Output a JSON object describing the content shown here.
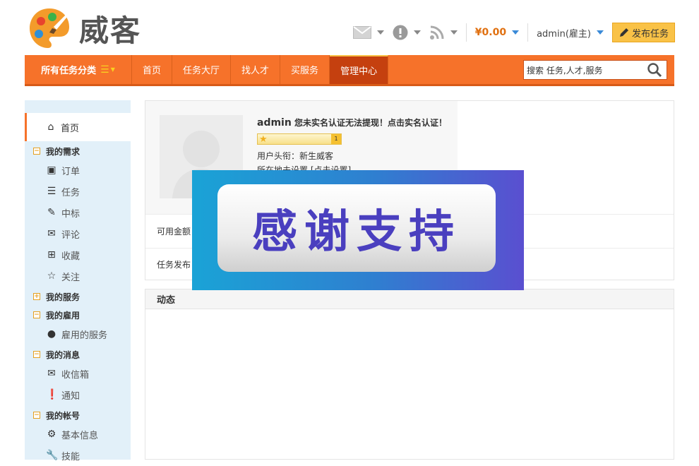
{
  "brand": {
    "name": "威客",
    "accent": "#f6722a"
  },
  "topbar": {
    "message_icon": "mail-icon",
    "notice_icon": "alert-icon",
    "rss_icon": "rss-icon",
    "balance": "¥0.00",
    "user": "admin(雇主)",
    "publish_label": "发布任务"
  },
  "nav": {
    "all_categories": "所有任务分类",
    "items": [
      {
        "label": "首页"
      },
      {
        "label": "任务大厅"
      },
      {
        "label": "找人才"
      },
      {
        "label": "买服务"
      },
      {
        "label": "管理中心",
        "active": true
      }
    ],
    "search_value": "搜索 任务,人才,服务"
  },
  "sidebar": {
    "home": "首页",
    "groups": [
      {
        "title": "我的需求",
        "expanded": true,
        "items": [
          {
            "label": "订单",
            "icon": "order-icon"
          },
          {
            "label": "任务",
            "icon": "list-icon"
          },
          {
            "label": "中标",
            "icon": "edit-icon"
          },
          {
            "label": "评论",
            "icon": "comment-icon"
          },
          {
            "label": "收藏",
            "icon": "plus-square-icon"
          },
          {
            "label": "关注",
            "icon": "star-icon"
          }
        ]
      },
      {
        "title": "我的服务",
        "expanded": false,
        "items": []
      },
      {
        "title": "我的雇用",
        "expanded": true,
        "items": [
          {
            "label": "雇用的服务",
            "icon": "user-icon"
          }
        ]
      },
      {
        "title": "我的消息",
        "expanded": true,
        "items": [
          {
            "label": "收信箱",
            "icon": "mail-icon"
          },
          {
            "label": "通知",
            "icon": "alert-icon"
          }
        ]
      },
      {
        "title": "我的帐号",
        "expanded": true,
        "items": [
          {
            "label": "基本信息",
            "icon": "gear-icon"
          },
          {
            "label": "技能",
            "icon": "wrench-icon"
          }
        ]
      }
    ]
  },
  "profile": {
    "name": "admin",
    "warning": "您未实名认证无法提现！点击实名认证！",
    "level_badge": "1",
    "title_line": "用户头衔：新生威客",
    "location_line": "所在地未设置 [点击设置]"
  },
  "rows": {
    "available_balance": "可用金额",
    "tasks_published": "任务发布"
  },
  "feed": {
    "title": "动态"
  },
  "overlay": {
    "text": "感谢支持"
  }
}
